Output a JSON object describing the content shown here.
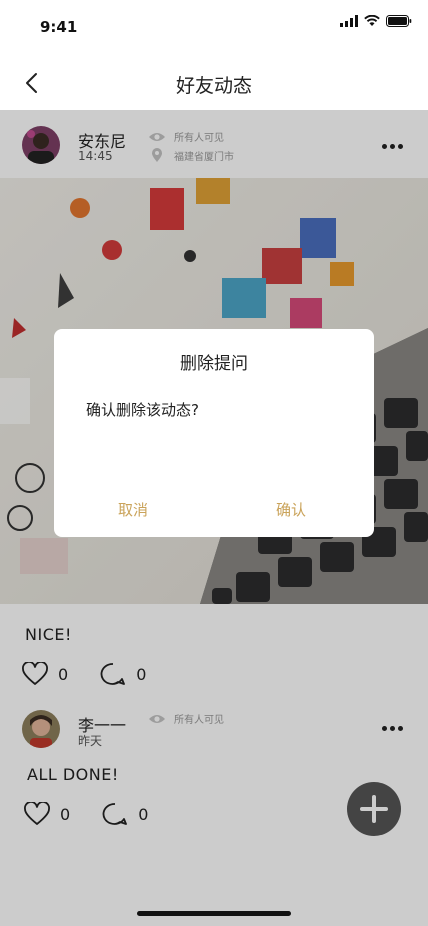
{
  "status_bar": {
    "time": "9:41"
  },
  "nav": {
    "title": "好友动态"
  },
  "posts": [
    {
      "user": "安东尼",
      "time": "14:45",
      "visibility": "所有人可见",
      "location": "福建省厦门市",
      "text": "NICE!",
      "likes": "0",
      "comments": "0"
    },
    {
      "user": "李一一",
      "time": "昨天",
      "visibility": "所有人可见",
      "text": "ALL DONE!",
      "likes": "0",
      "comments": "0"
    }
  ],
  "dialog": {
    "title": "删除提问",
    "message": "确认删除该动态?",
    "cancel_label": "取消",
    "confirm_label": "确认"
  },
  "colors": {
    "dialog_accent": "#caa35a",
    "fab": "#555555"
  }
}
